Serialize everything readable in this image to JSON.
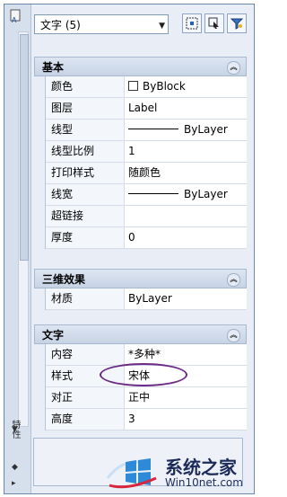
{
  "object_select": {
    "value": "文字 (5)"
  },
  "side": {
    "label": "特性"
  },
  "sections": {
    "basic": {
      "title": "基本",
      "rows": [
        {
          "key": "颜色",
          "value": "ByBlock"
        },
        {
          "key": "图层",
          "value": "Label"
        },
        {
          "key": "线型",
          "value": "ByLayer"
        },
        {
          "key": "线型比例",
          "value": "1"
        },
        {
          "key": "打印样式",
          "value": "随颜色"
        },
        {
          "key": "线宽",
          "value": "ByLayer"
        },
        {
          "key": "超链接",
          "value": ""
        },
        {
          "key": "厚度",
          "value": "0"
        }
      ]
    },
    "3d": {
      "title": "三维效果",
      "rows": [
        {
          "key": "材质",
          "value": "ByLayer"
        }
      ]
    },
    "text": {
      "title": "文字",
      "rows": [
        {
          "key": "内容",
          "value": "*多种*"
        },
        {
          "key": "样式",
          "value": "宋体"
        },
        {
          "key": "对正",
          "value": "正中"
        },
        {
          "key": "高度",
          "value": "3"
        }
      ]
    }
  },
  "watermark": {
    "title": "系统之家",
    "subtitle": "Win10net.com"
  },
  "colors": {
    "highlight": "#6a2a83",
    "header": "#c7d3e5"
  }
}
